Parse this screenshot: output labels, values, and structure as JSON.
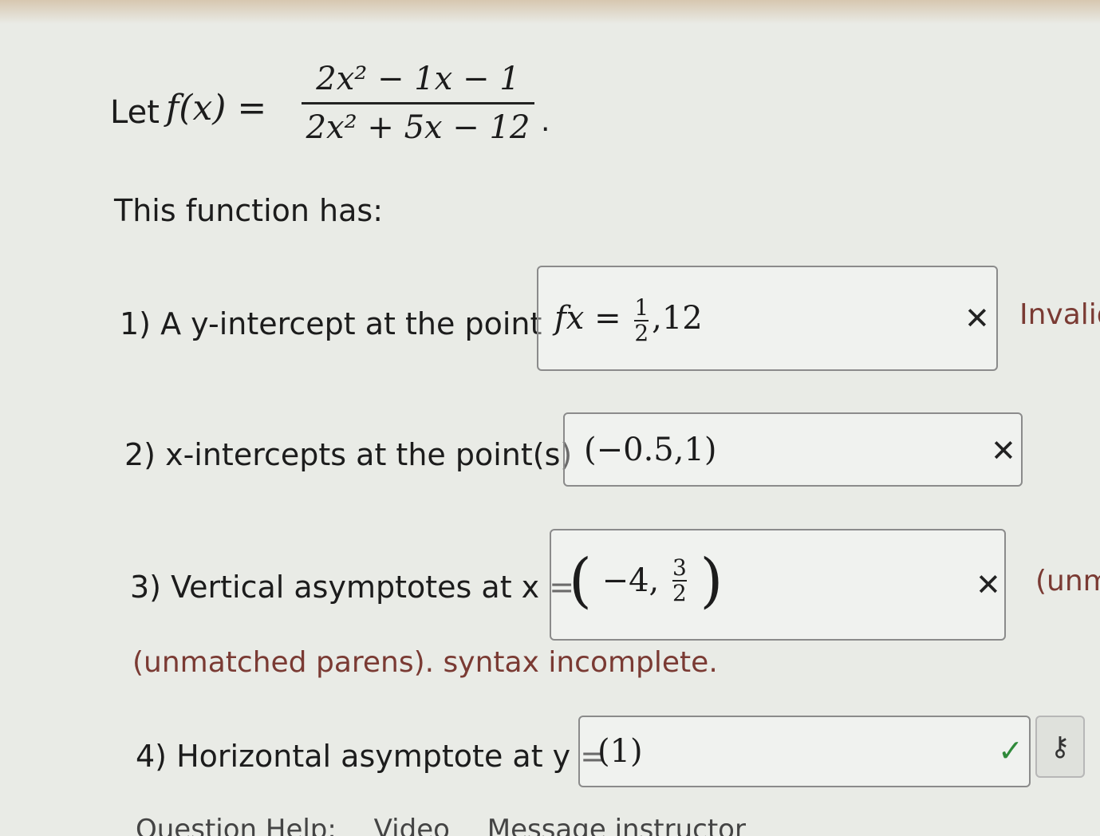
{
  "problem": {
    "let_label": "Let",
    "function_name": "f(x) =",
    "numerator": "2x² − 1x − 1",
    "denominator": "2x² + 5x − 12",
    "period": "."
  },
  "intro": "This function has:",
  "questions": [
    {
      "label": "1) A y-intercept at the point",
      "answer": {
        "lhs": "fx =",
        "frac_num": "1",
        "frac_den": "2",
        "rest": ",12"
      },
      "mark": "✕",
      "feedback": "Invalid"
    },
    {
      "label": "2) x-intercepts at the point(s)",
      "answer": "(−0.5,1)",
      "mark": "✕"
    },
    {
      "label": "3) Vertical asymptotes at x =",
      "answer": {
        "open": "(",
        "lhs": "−4,",
        "frac_num": "3",
        "frac_den": "2",
        "close": ")"
      },
      "mark": "✕",
      "feedback_side": "(unm",
      "feedback": "(unmatched parens). syntax incomplete."
    },
    {
      "label": "4) Horizontal asymptote at y =",
      "answer": "(1)",
      "mark": "✓",
      "key_icon": "key-icon"
    }
  ],
  "bottom_links": [
    "Question Help:",
    "Video",
    "Message instructor"
  ],
  "colors": {
    "background": "#e9ebe6",
    "feedback": "#7a3a33",
    "correct": "#2f8a3a",
    "border": "#8b8b8b"
  }
}
